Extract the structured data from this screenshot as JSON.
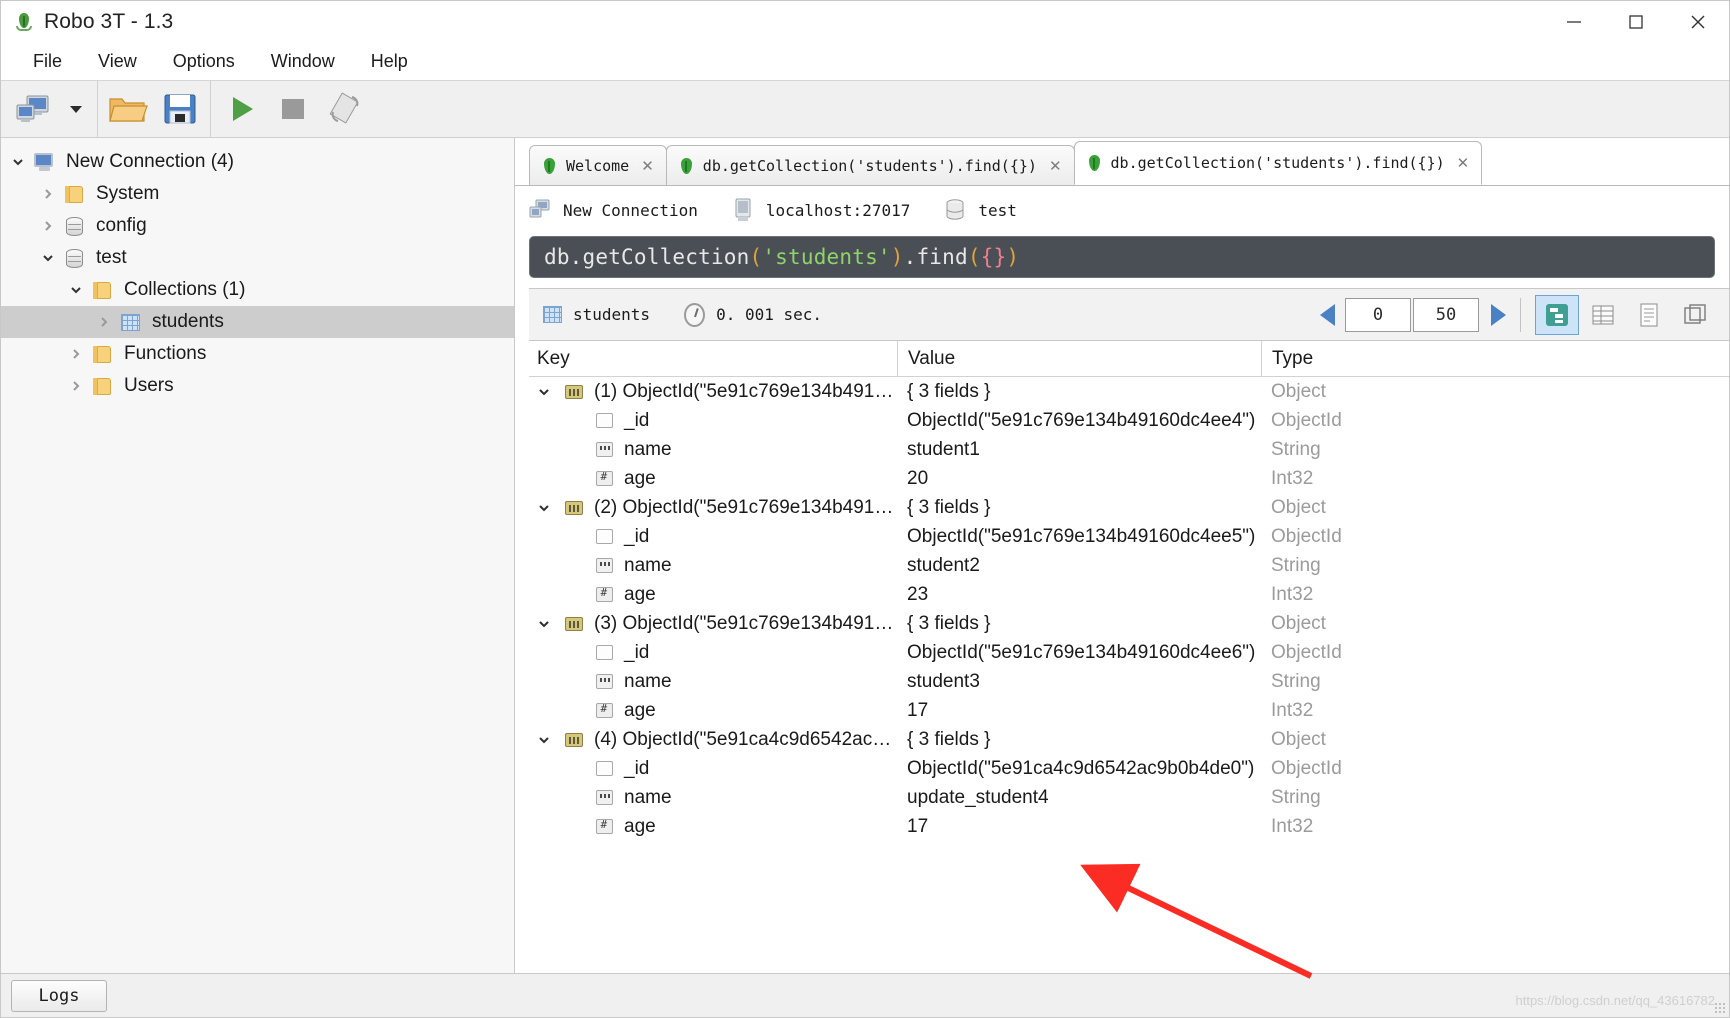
{
  "window": {
    "title": "Robo 3T - 1.3",
    "logo_icon": "robomongo-leaf-icon",
    "minimize_label": "─",
    "maximize_label": "☐",
    "close_label": "✕"
  },
  "menubar": {
    "items": [
      {
        "label": "File"
      },
      {
        "label": "View"
      },
      {
        "label": "Options"
      },
      {
        "label": "Window"
      },
      {
        "label": "Help"
      }
    ]
  },
  "toolbar": {
    "buttons": [
      {
        "name": "connect-button",
        "icon": "computer-connect-icon"
      },
      {
        "name": "connect-dropdown",
        "icon": "chevron-down-icon"
      },
      {
        "name": "open-script-button",
        "icon": "folder-open-icon"
      },
      {
        "name": "save-script-button",
        "icon": "floppy-disk-save-icon"
      },
      {
        "name": "execute-button",
        "icon": "play-triangle-icon"
      },
      {
        "name": "stop-button",
        "icon": "stop-square-icon"
      },
      {
        "name": "rotate-button",
        "icon": "orientation-toggle-icon"
      }
    ]
  },
  "sidebar": {
    "tree": [
      {
        "label": "New Connection (4)",
        "icon": "server-icon",
        "twisty": "open",
        "depth": 0,
        "selected": false
      },
      {
        "label": "System",
        "icon": "folder-icon",
        "twisty": "collapsed",
        "depth": 1,
        "selected": false
      },
      {
        "label": "config",
        "icon": "database-icon",
        "twisty": "collapsed",
        "depth": 1,
        "selected": false
      },
      {
        "label": "test",
        "icon": "database-icon",
        "twisty": "open",
        "depth": 1,
        "selected": false
      },
      {
        "label": "Collections (1)",
        "icon": "folder-icon",
        "twisty": "open",
        "depth": 2,
        "selected": false
      },
      {
        "label": "students",
        "icon": "collection-grid-icon",
        "twisty": "collapsed",
        "depth": 3,
        "selected": true
      },
      {
        "label": "Functions",
        "icon": "folder-icon",
        "twisty": "collapsed",
        "depth": 2,
        "selected": false
      },
      {
        "label": "Users",
        "icon": "folder-icon",
        "twisty": "collapsed",
        "depth": 2,
        "selected": false
      }
    ]
  },
  "tabs": [
    {
      "label": "Welcome",
      "icon": "leaf-icon",
      "close": "✕",
      "active": false
    },
    {
      "label": "db.getCollection('students').find({})",
      "icon": "leaf-icon",
      "close": "✕",
      "active": false
    },
    {
      "label": "db.getCollection('students').find({})",
      "icon": "leaf-icon",
      "close": "✕",
      "active": true
    }
  ],
  "connection_info": {
    "connection_name": "New Connection",
    "host": "localhost:27017",
    "database": "test",
    "connection_icon": "server-icon",
    "host_icon": "computer-icon",
    "db_icon": "database-icon"
  },
  "query": {
    "full_text": "db.getCollection('students').find({})",
    "prefix": "db.getCollection",
    "open_paren": "(",
    "string": "'students'",
    "close_paren": ")",
    "method": ".find",
    "open_paren2": "(",
    "braces": "{}",
    "close_paren2": ")",
    "colors": {
      "background": "#4a4f55",
      "text": "#e8e8e8",
      "paren": "#e0a33c",
      "string": "#8fd46b",
      "brace": "#f07f8c"
    }
  },
  "results_toolbar": {
    "collection_label": "students",
    "collection_icon": "collection-grid-icon",
    "time_label": "0. 001 sec.",
    "clock_icon": "clock-icon",
    "prev_icon": "arrow-left-icon",
    "next_icon": "arrow-right-icon",
    "skip_value": "0",
    "limit_value": "50",
    "view_buttons": [
      {
        "name": "tree-view-button",
        "icon": "tree-view-icon",
        "active": true
      },
      {
        "name": "table-view-button",
        "icon": "table-view-icon",
        "active": false
      },
      {
        "name": "text-view-button",
        "icon": "text-view-icon",
        "active": false
      },
      {
        "name": "maximize-view-button",
        "icon": "expand-icon",
        "active": false
      }
    ]
  },
  "results_table": {
    "columns": {
      "key": "Key",
      "value": "Value",
      "type": "Type"
    },
    "rows": [
      {
        "key": "(1) ObjectId(\"5e91c769e134b49160...",
        "value": "{ 3 fields }",
        "type": "Object",
        "icon": "document-icon",
        "twisty": "open",
        "indent": 0
      },
      {
        "key": "_id",
        "value": "ObjectId(\"5e91c769e134b49160dc4ee4\")",
        "type": "ObjectId",
        "icon": "objectid-icon",
        "twisty": "none",
        "indent": 1
      },
      {
        "key": "name",
        "value": "student1",
        "type": "String",
        "icon": "string-icon",
        "twisty": "none",
        "indent": 1
      },
      {
        "key": "age",
        "value": "20",
        "type": "Int32",
        "icon": "int-icon",
        "twisty": "none",
        "indent": 1
      },
      {
        "key": "(2) ObjectId(\"5e91c769e134b49160...",
        "value": "{ 3 fields }",
        "type": "Object",
        "icon": "document-icon",
        "twisty": "open",
        "indent": 0
      },
      {
        "key": "_id",
        "value": "ObjectId(\"5e91c769e134b49160dc4ee5\")",
        "type": "ObjectId",
        "icon": "objectid-icon",
        "twisty": "none",
        "indent": 1
      },
      {
        "key": "name",
        "value": "student2",
        "type": "String",
        "icon": "string-icon",
        "twisty": "none",
        "indent": 1
      },
      {
        "key": "age",
        "value": "23",
        "type": "Int32",
        "icon": "int-icon",
        "twisty": "none",
        "indent": 1
      },
      {
        "key": "(3) ObjectId(\"5e91c769e134b49160...",
        "value": "{ 3 fields }",
        "type": "Object",
        "icon": "document-icon",
        "twisty": "open",
        "indent": 0
      },
      {
        "key": "_id",
        "value": "ObjectId(\"5e91c769e134b49160dc4ee6\")",
        "type": "ObjectId",
        "icon": "objectid-icon",
        "twisty": "none",
        "indent": 1
      },
      {
        "key": "name",
        "value": "student3",
        "type": "String",
        "icon": "string-icon",
        "twisty": "none",
        "indent": 1
      },
      {
        "key": "age",
        "value": "17",
        "type": "Int32",
        "icon": "int-icon",
        "twisty": "none",
        "indent": 1
      },
      {
        "key": "(4) ObjectId(\"5e91ca4c9d6542ac9b0...",
        "value": "{ 3 fields }",
        "type": "Object",
        "icon": "document-icon",
        "twisty": "open",
        "indent": 0
      },
      {
        "key": "_id",
        "value": "ObjectId(\"5e91ca4c9d6542ac9b0b4de0\")",
        "type": "ObjectId",
        "icon": "objectid-icon",
        "twisty": "none",
        "indent": 1
      },
      {
        "key": "name",
        "value": "update_student4",
        "type": "String",
        "icon": "string-icon",
        "twisty": "none",
        "indent": 1
      },
      {
        "key": "age",
        "value": "17",
        "type": "Int32",
        "icon": "int-icon",
        "twisty": "none",
        "indent": 1
      }
    ]
  },
  "statusbar": {
    "logs_label": "Logs",
    "watermark": "https://blog.csdn.net/qq_43616782"
  },
  "annotation": {
    "type": "arrow",
    "color": "#fb2c23",
    "points_to": "update_student4"
  }
}
